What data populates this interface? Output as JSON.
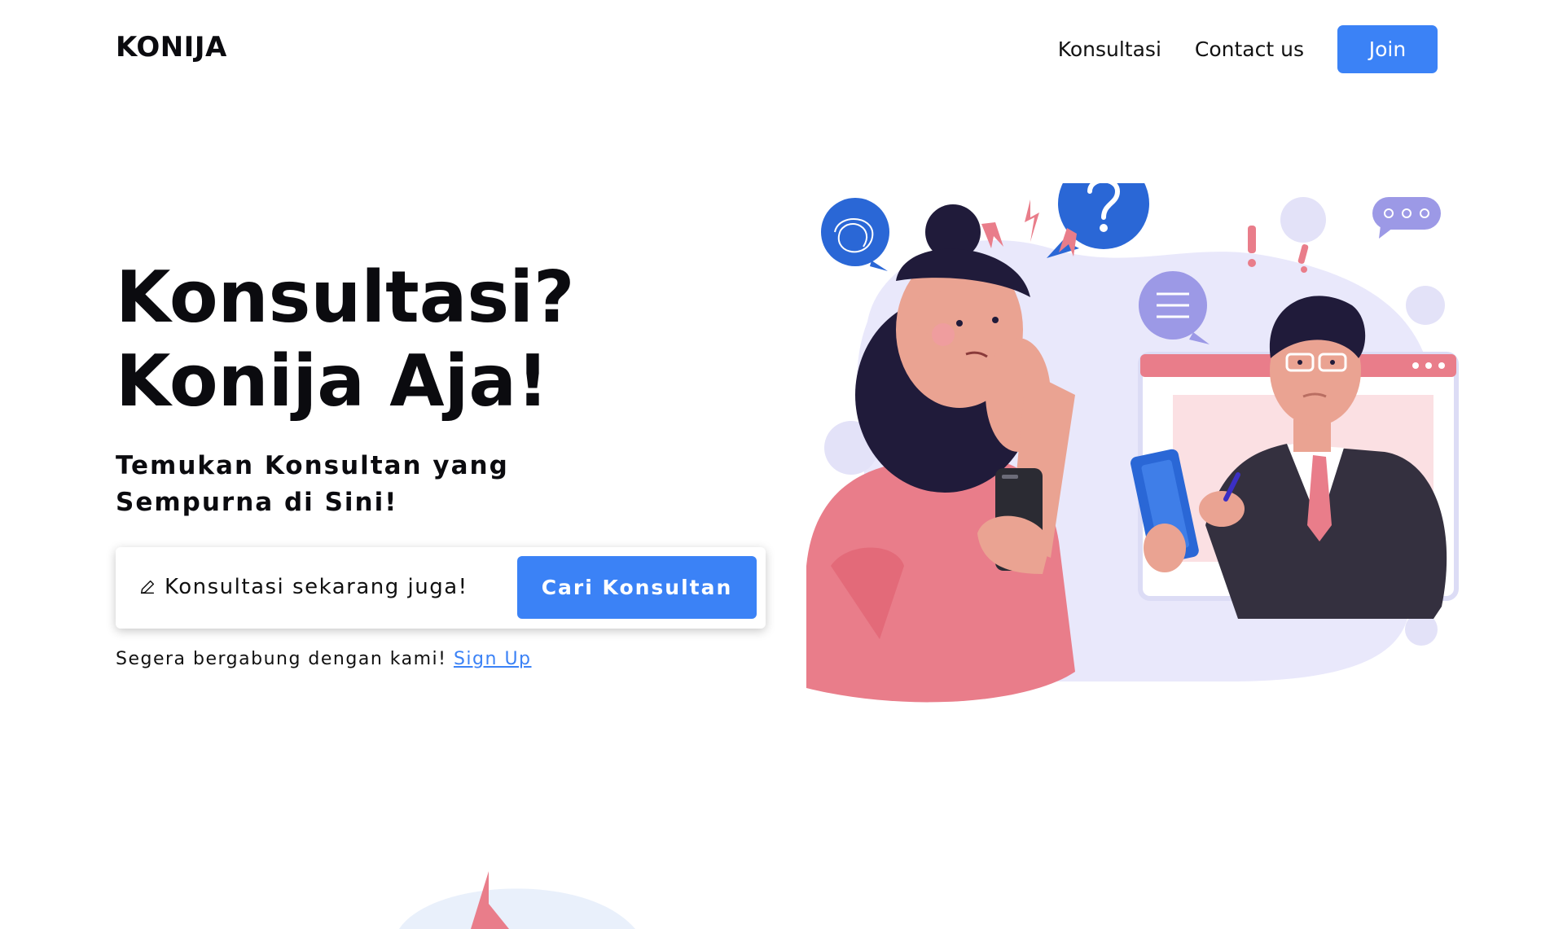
{
  "brand": {
    "logo": "KONIJA"
  },
  "nav": {
    "links": [
      {
        "label": "Konsultasi"
      },
      {
        "label": "Contact us"
      }
    ],
    "join_label": "Join"
  },
  "hero": {
    "title_line1": "Konsultasi?",
    "title_line2": "Konija Aja!",
    "subtitle": "Temukan Konsultan yang Sempurna di Sini!"
  },
  "search": {
    "placeholder": "Konsultasi sekarang juga!",
    "button_label": "Cari Konsultan",
    "icon": "pencil-icon"
  },
  "signup": {
    "text": "Segera bergabung dengan kami!",
    "link_label": "Sign Up"
  },
  "colors": {
    "accent": "#3b82f6",
    "text": "#0b0b0f",
    "pink": "#e97d8a",
    "lavender": "#e9e8fb",
    "dark_hair": "#201b3a"
  }
}
